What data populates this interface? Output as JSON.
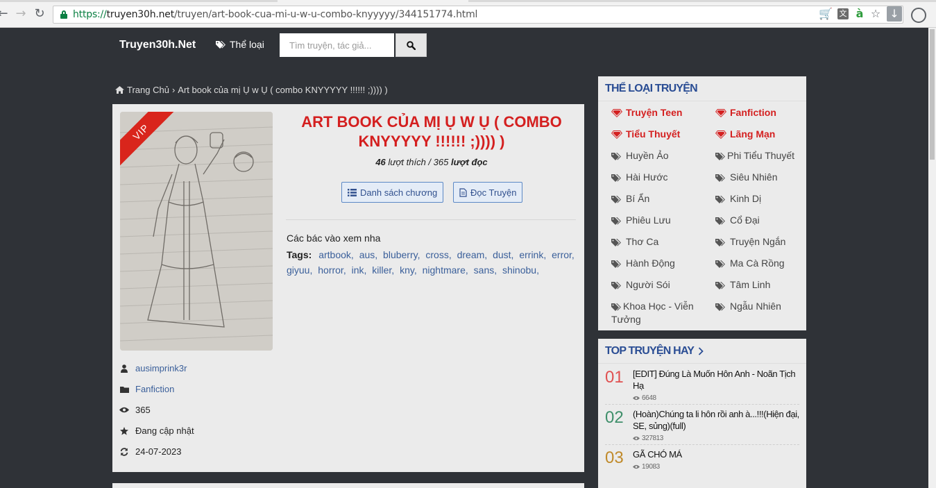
{
  "browser": {
    "url_scheme": "https://",
    "url_host": "truyen30h.net",
    "url_path": "/truyen/art-book-cua-mi-u-w-u-combo-knyyyyy/344151774.html",
    "icons": [
      "back-icon",
      "forward-icon",
      "reload-icon",
      "lock-icon",
      "cart-icon",
      "translate-icon",
      "bookmark-star-icon",
      "download-icon",
      "profile-circle-icon"
    ]
  },
  "header": {
    "brand": "Truyen30h.Net",
    "genre_menu": "Thể loại",
    "search_placeholder": "Tìm truyện, tác giả..."
  },
  "breadcrumb": {
    "home": "Trang Chủ",
    "separator": "›",
    "current": "Art book của mị Ụ w Ụ ( combo KNYYYYY !!!!!! ;)))) )"
  },
  "story": {
    "badge": "VIP",
    "title": "ART BOOK CỦA MỊ Ụ W Ụ ( COMBO KNYYYYY !!!!!! ;)))) )",
    "likes": "46",
    "likes_label": "lượt thích /",
    "reads": "365",
    "reads_label": "lượt đọc",
    "chapters_button": "Danh sách chương",
    "read_button": "Đọc Truyện",
    "description": "Các bác vào xem nha",
    "tags_label": "Tags:",
    "tags": [
      "artbook,",
      "aus,",
      "bluberry,",
      "cross,",
      "dream,",
      "dust,",
      "errink,",
      "error,",
      "giyuu,",
      "horror,",
      "ink,",
      "killer,",
      "kny,",
      "nightmare,",
      "sans,",
      "shinobu,"
    ],
    "author": "ausimprink3r",
    "category": "Fanfiction",
    "views": "365",
    "status": "Đang cập nhật",
    "updated": "24-07-2023"
  },
  "sidebar": {
    "genres_title": "THỂ LOẠI TRUYỆN",
    "genres": [
      {
        "label": "Truyện Teen",
        "hot": true
      },
      {
        "label": "Fanfiction",
        "hot": true
      },
      {
        "label": "Tiểu Thuyết",
        "hot": true
      },
      {
        "label": "Lãng Mạn",
        "hot": true
      },
      {
        "label": "Huyền Ảo",
        "hot": false
      },
      {
        "label": "Phi Tiểu Thuyết",
        "hot": false
      },
      {
        "label": "Hài Hước",
        "hot": false
      },
      {
        "label": "Siêu Nhiên",
        "hot": false
      },
      {
        "label": "Bí Ẩn",
        "hot": false
      },
      {
        "label": "Kinh Dị",
        "hot": false
      },
      {
        "label": "Phiêu Lưu",
        "hot": false
      },
      {
        "label": "Cổ Đại",
        "hot": false
      },
      {
        "label": "Thơ Ca",
        "hot": false
      },
      {
        "label": "Truyện Ngắn",
        "hot": false
      },
      {
        "label": "Hành Động",
        "hot": false
      },
      {
        "label": "Ma Cà Rồng",
        "hot": false
      },
      {
        "label": "Người Sói",
        "hot": false
      },
      {
        "label": "Tâm Linh",
        "hot": false
      },
      {
        "label": "Khoa Học - Viễn Tưởng",
        "hot": false
      },
      {
        "label": "Ngẫu Nhiên",
        "hot": false
      }
    ],
    "top_title": "TOP TRUYỆN HAY",
    "top": [
      {
        "rank": "01",
        "title": "[EDIT] Đúng Là Muốn Hôn Anh - Noãn Tịch Hạ",
        "views": "6648",
        "color": "#e05050"
      },
      {
        "rank": "02",
        "title": "(Hoàn)Chúng ta li hôn rồi anh à...!!!(Hiện đại, SE, sủng)(full)",
        "views": "327813",
        "color": "#3f8f6a"
      },
      {
        "rank": "03",
        "title": "GÃ CHÓ MÁ",
        "views": "19083",
        "color": "#c08a2a"
      }
    ]
  },
  "colors": {
    "page_bg": "#2f3237",
    "title_red": "#d41f1f",
    "link_blue": "#3a5f9a",
    "panel_title": "#2a4d94"
  }
}
